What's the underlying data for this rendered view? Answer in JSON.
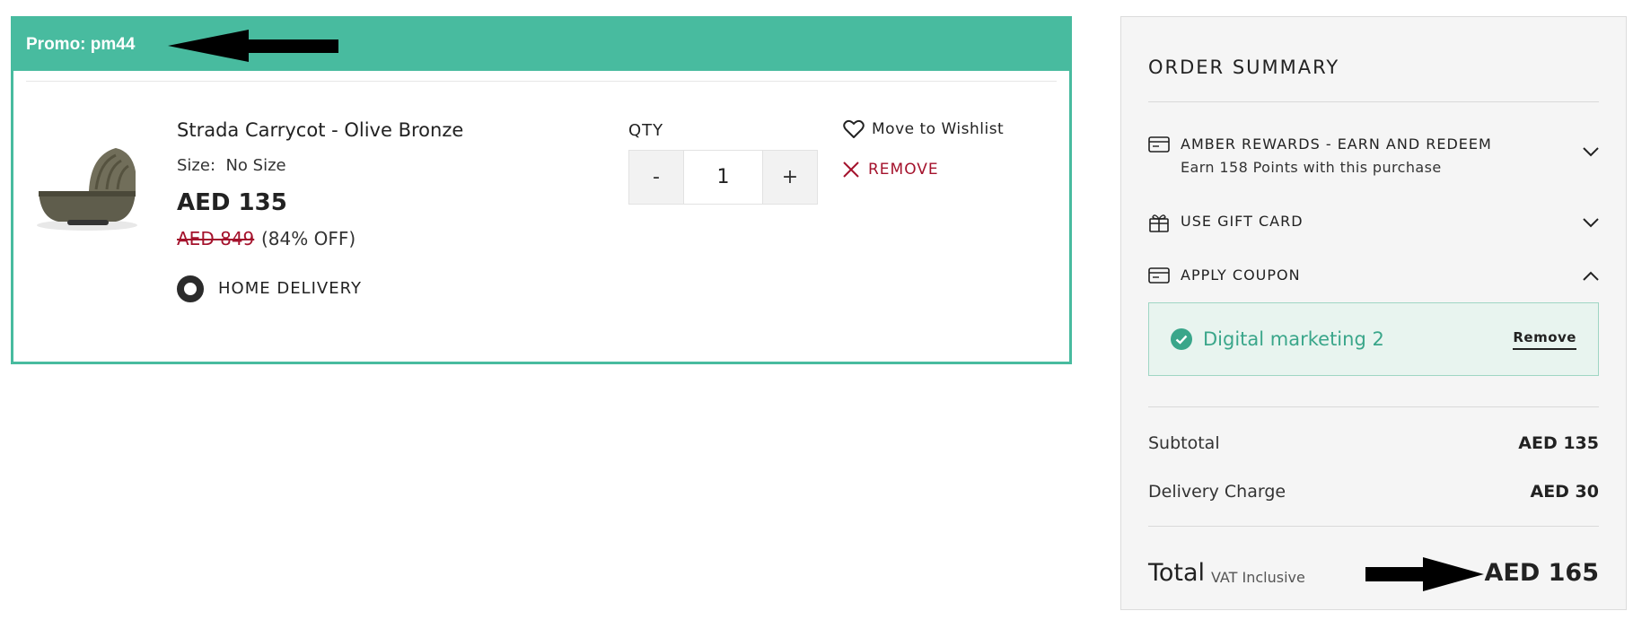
{
  "promo": {
    "text": "Promo: pm44",
    "accent_color": "#48bb9f"
  },
  "cart_item": {
    "name": "Strada Carrycot - Olive Bronze",
    "size_label": "Size:",
    "size_value": "No Size",
    "price": "AED 135",
    "original_price": "AED 849",
    "discount": "(84% OFF)",
    "delivery_option": "HOME DELIVERY",
    "qty_label": "QTY",
    "qty_minus": "-",
    "qty_value": "1",
    "qty_plus": "+",
    "wishlist_label": "Move to Wishlist",
    "remove_label": "REMOVE",
    "remove_color": "#a4122c"
  },
  "order_summary": {
    "title": "ORDER SUMMARY",
    "rewards": {
      "title": "AMBER REWARDS - EARN AND REDEEM",
      "subtitle": "Earn 158 Points with this purchase"
    },
    "gift_card": {
      "title": "USE GIFT CARD"
    },
    "coupon": {
      "title": "APPLY COUPON",
      "applied_name": "Digital marketing 2",
      "remove_label": "Remove"
    },
    "subtotal_label": "Subtotal",
    "subtotal_value": "AED 135",
    "delivery_label": "Delivery Charge",
    "delivery_value": "AED 30",
    "total_label": "Total",
    "vat_label": "VAT Inclusive",
    "total_value": "AED 165"
  }
}
